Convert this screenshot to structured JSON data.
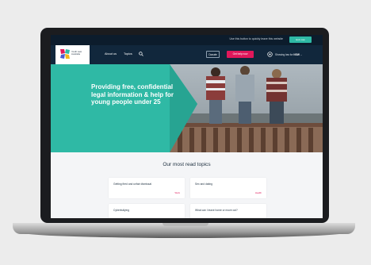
{
  "topbar": {
    "message": "Use this button to quickly leave this website",
    "exit_label": "Exit now"
  },
  "nav": {
    "logo_text": "Youth Law Australia",
    "links": [
      "About us",
      "Topics"
    ],
    "outline_button": "Donate",
    "primary_button": "Get help now",
    "location_prefix": "Showing law for",
    "location_value": "NSW"
  },
  "hero": {
    "title": "Providing free, confidential legal information & help for young people under 25"
  },
  "topics": {
    "heading": "Our most read topics",
    "cards": [
      {
        "title": "Getting fired and unfair dismissal",
        "link": "Work"
      },
      {
        "title": "Sex and dating",
        "link": "Health"
      },
      {
        "title": "Cyberbullying",
        "link": ""
      },
      {
        "title": "What can I leave home or move out?",
        "link": ""
      }
    ]
  },
  "colors": {
    "navy": "#11273c",
    "teal": "#2fb9a5",
    "pink": "#e0185b"
  }
}
